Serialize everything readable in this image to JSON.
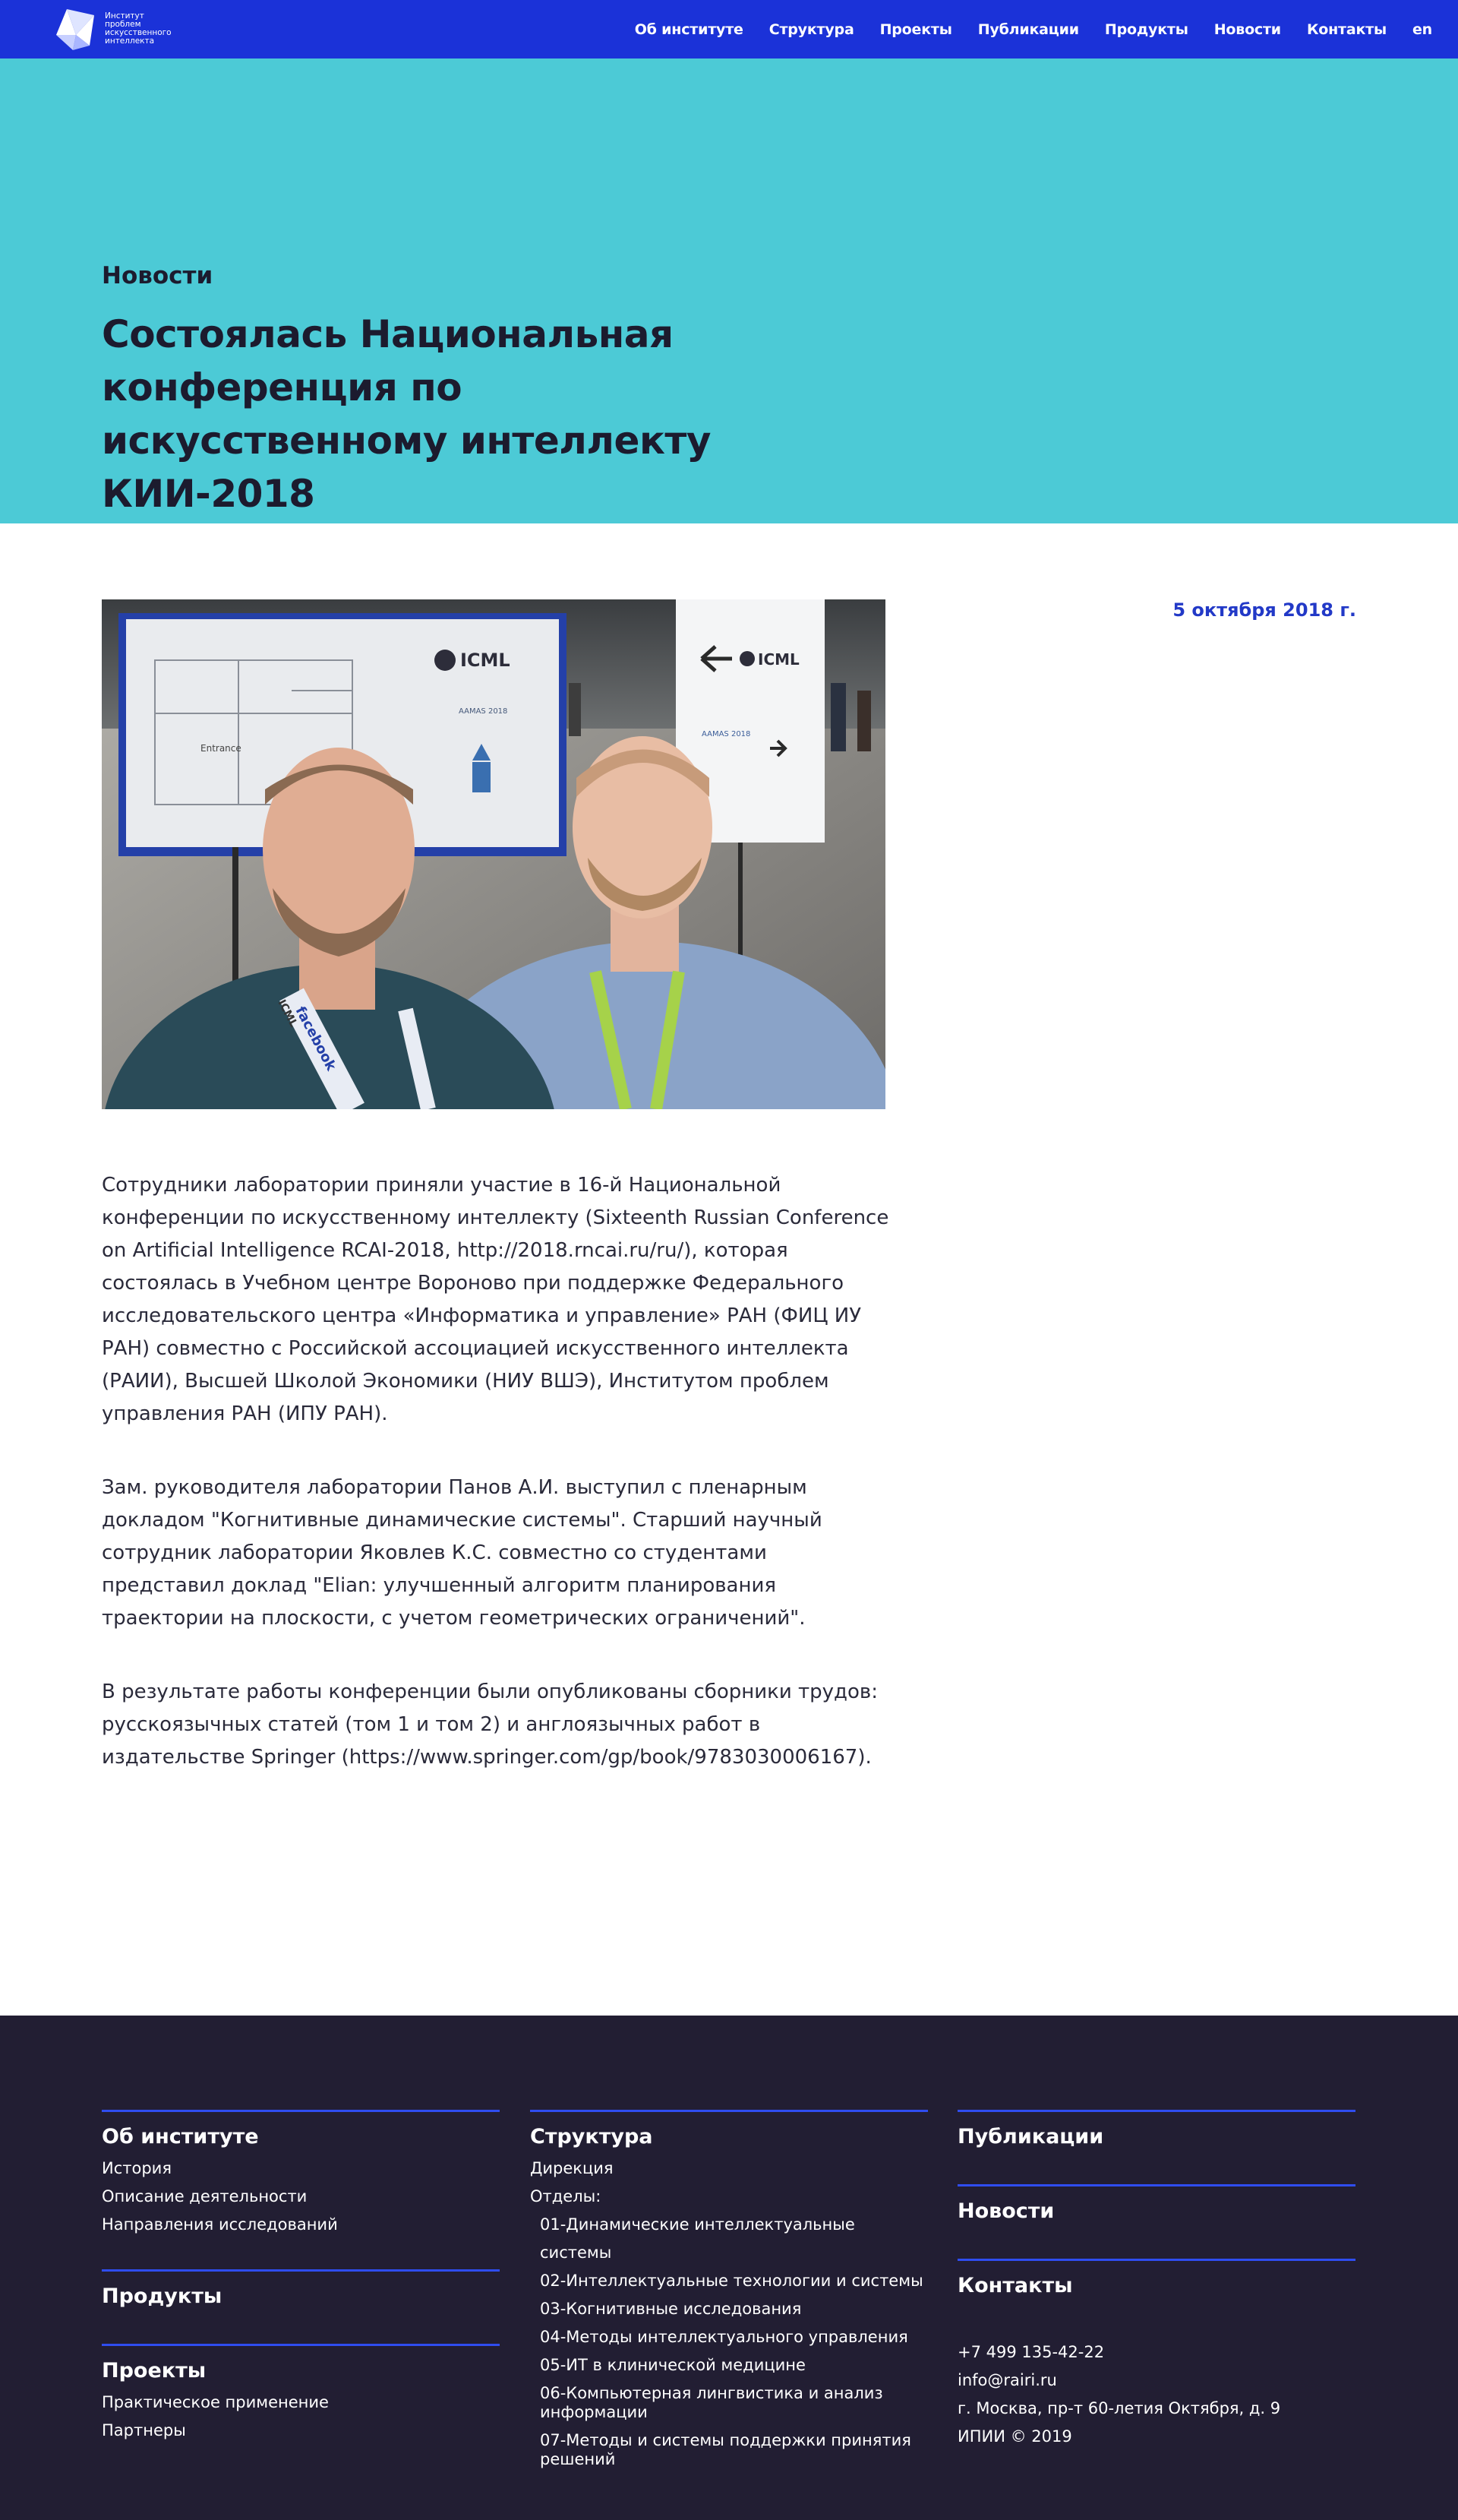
{
  "logo": {
    "text_lines": [
      "Институт",
      "проблем",
      "искусственного",
      "интеллекта"
    ]
  },
  "nav": {
    "items": [
      "Об институте",
      "Структура",
      "Проекты",
      "Публикации",
      "Продукты",
      "Новости",
      "Контакты",
      "en"
    ]
  },
  "hero": {
    "kicker": "Новости",
    "title": "Состоялась Национальная конференция по искусственному интеллекту КИИ-2018",
    "background": "#4ccad6"
  },
  "article": {
    "date": "5 октября 2018 г.",
    "paragraphs": [
      "Сотрудники лаборатории приняли участие в 16-й Национальной конференции по искусственному интеллекту (Sixteenth Russian Conference on Artificial Intelligence RCAI-2018, http://2018.rncai.ru/ru/), которая состоялась в Учебном центре Вороново при поддержке Федерального исследовательского центра «Информатика и управление» РАН (ФИЦ ИУ РАН) совместно с Российской ассоциацией искусственного интеллекта (РАИИ), Высшей Школой Экономики (НИУ ВШЭ), Институтом проблем управления РАН (ИПУ РАН).",
      "Зам. руководителя лаборатории Панов А.И. выступил с пленарным докладом \"Когнитивные динамические системы\". Старший научный сотрудник лаборатории Яковлев К.С. совместно со студентами представил доклад \"Elian: улучшенный алгоритм планирования траектории на плоскости, с учетом геометрических ограничений\".",
      "В результате работы конференции были опубликованы сборники трудов: русскоязычных статей (том 1 и том 2) и англоязычных работ в издательстве Springer (https://www.springer.com/gp/book/9783030006167)."
    ],
    "photo": {
      "sign_left": "ICML",
      "sign_right": "ICML",
      "aamas_left": "AAMAS 2018",
      "aamas_right": "AAMAS 2018",
      "map_label": "Entrance",
      "lanyard": "facebook",
      "badge": "ICML"
    }
  },
  "footer": {
    "about": {
      "title": "Об институте",
      "links": [
        "История",
        "Описание деятельности",
        "Направления исследований"
      ]
    },
    "products": {
      "title": "Продукты"
    },
    "projects": {
      "title": "Проекты",
      "links": [
        "Практическое применение",
        "Партнеры"
      ]
    },
    "structure": {
      "title": "Структура",
      "direction": "Дирекция",
      "departments_label": "Отделы:",
      "departments": [
        "01-Динамические интеллектуальные системы",
        "02-Интеллектуальные технологии и системы",
        "03-Когнитивные исследования",
        "04-Методы интеллектуального управления",
        "05-ИТ в клинической медицине",
        "06-Компьютерная лингвистика и анализ информации",
        "07-Методы и системы поддержки принятия решений"
      ]
    },
    "publications": {
      "title": "Публикации"
    },
    "news": {
      "title": "Новости"
    },
    "contacts": {
      "title": "Контакты",
      "phone": "+7 499 135-42-22",
      "email": "info@rairi.ru",
      "address": "г. Москва, пр-т 60-летия Октября, д. 9",
      "copyright": "ИПИИ © 2019"
    },
    "accent": "#2f4df0",
    "background": "#221e33"
  }
}
